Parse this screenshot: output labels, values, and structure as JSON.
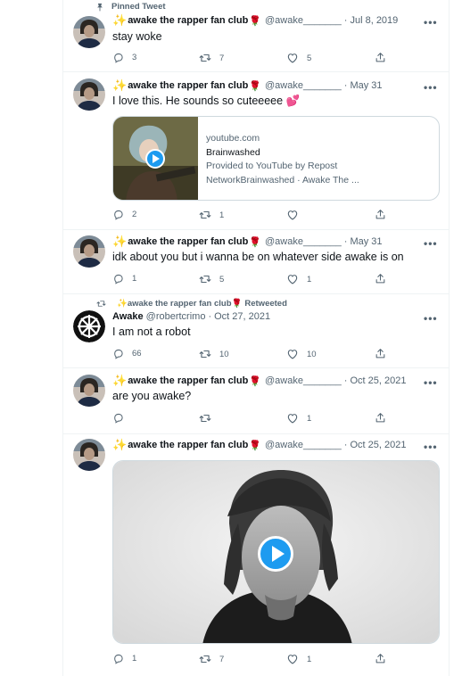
{
  "pinned_label": "Pinned Tweet",
  "account": {
    "name": "awake the rapper fan club",
    "handle": "@awake_______",
    "retweeted_label": "Retweeted"
  },
  "tweets": [
    {
      "date": "Jul 8, 2019",
      "text": "stay woke",
      "replies": "3",
      "retweets": "7",
      "likes": "5"
    },
    {
      "date": "May 31",
      "text": "I love this. He sounds so cuteeeee",
      "card": {
        "domain": "youtube.com",
        "title": "Brainwashed",
        "desc_line1": "Provided to YouTube by Repost",
        "desc_line2": "NetworkBrainwashed · Awake The ..."
      },
      "replies": "2",
      "retweets": "1",
      "likes": ""
    },
    {
      "date": "May 31",
      "text": "idk about you but i wanna be on whatever side awake is on",
      "replies": "1",
      "retweets": "5",
      "likes": "1"
    },
    {
      "author_name": "Awake",
      "author_handle": "@robertcrimo",
      "date": "Oct 27, 2021",
      "text": "I am not a robot",
      "replies": "66",
      "retweets": "10",
      "likes": "10"
    },
    {
      "date": "Oct 25, 2021",
      "text": "are you awake?",
      "replies": "",
      "retweets": "",
      "likes": "1"
    },
    {
      "date": "Oct 25, 2021",
      "text": "",
      "replies": "1",
      "retweets": "7",
      "likes": "1"
    }
  ],
  "icons": {
    "pin": "pin-icon",
    "reply": "reply-icon",
    "retweet": "retweet-icon",
    "like": "heart-icon",
    "share": "share-icon",
    "more": "more-icon",
    "play": "play-icon"
  },
  "colors": {
    "accent": "#1d9bf0",
    "muted": "#536471",
    "border": "#eff3f4",
    "sparkle": "#f4b400",
    "rose": "#c0152f"
  }
}
